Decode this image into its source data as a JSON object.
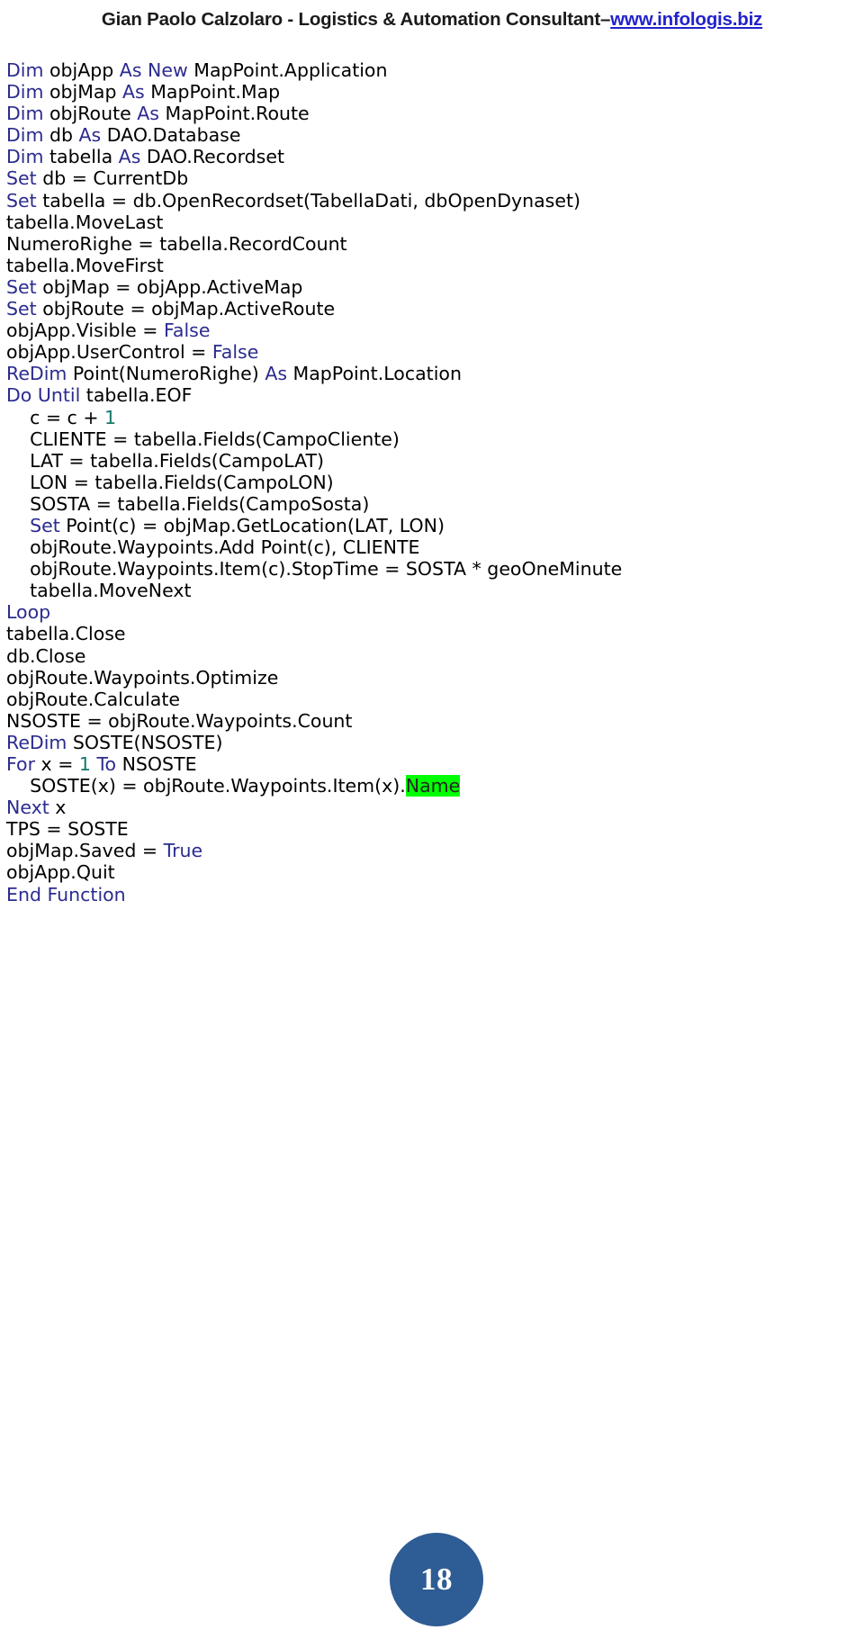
{
  "header": {
    "author_and_role": "Gian Paolo Calzolaro - Logistics & Automation Consultant ",
    "separator": "– ",
    "website": "www.infologis.biz"
  },
  "code": {
    "language": "VBA",
    "keyword_color": "#2b2b8f",
    "text_color": "#000000",
    "number_color": "#17776b",
    "highlight_color": "#00ff00",
    "lines": [
      [
        {
          "t": "Dim",
          "c": "kw"
        },
        {
          "t": " objApp ",
          "c": "plain"
        },
        {
          "t": "As New",
          "c": "kw"
        },
        {
          "t": " MapPoint.Application",
          "c": "plain"
        }
      ],
      [
        {
          "t": "Dim",
          "c": "kw"
        },
        {
          "t": " objMap ",
          "c": "plain"
        },
        {
          "t": "As",
          "c": "kw"
        },
        {
          "t": " MapPoint.Map",
          "c": "plain"
        }
      ],
      [
        {
          "t": "Dim",
          "c": "kw"
        },
        {
          "t": " objRoute ",
          "c": "plain"
        },
        {
          "t": "As",
          "c": "kw"
        },
        {
          "t": " MapPoint.Route",
          "c": "plain"
        }
      ],
      [
        {
          "t": "Dim",
          "c": "kw"
        },
        {
          "t": " db ",
          "c": "plain"
        },
        {
          "t": "As",
          "c": "kw"
        },
        {
          "t": " DAO.Database",
          "c": "plain"
        }
      ],
      [
        {
          "t": "Dim",
          "c": "kw"
        },
        {
          "t": " tabella ",
          "c": "plain"
        },
        {
          "t": "As",
          "c": "kw"
        },
        {
          "t": " DAO.Recordset",
          "c": "plain"
        }
      ],
      [
        {
          "t": "Set",
          "c": "kw"
        },
        {
          "t": " db = CurrentDb",
          "c": "plain"
        }
      ],
      [
        {
          "t": "Set",
          "c": "kw"
        },
        {
          "t": " tabella = db.OpenRecordset(TabellaDati, dbOpenDynaset)",
          "c": "plain"
        }
      ],
      [
        {
          "t": "tabella.MoveLast",
          "c": "plain"
        }
      ],
      [
        {
          "t": "NumeroRighe = tabella.RecordCount",
          "c": "plain"
        }
      ],
      [
        {
          "t": "tabella.MoveFirst",
          "c": "plain"
        }
      ],
      [
        {
          "t": "Set",
          "c": "kw"
        },
        {
          "t": " objMap = objApp.ActiveMap",
          "c": "plain"
        }
      ],
      [
        {
          "t": "Set",
          "c": "kw"
        },
        {
          "t": " objRoute = objMap.ActiveRoute",
          "c": "plain"
        }
      ],
      [
        {
          "t": "objApp.Visible = ",
          "c": "plain"
        },
        {
          "t": "False",
          "c": "kw"
        }
      ],
      [
        {
          "t": "objApp.UserControl = ",
          "c": "plain"
        },
        {
          "t": "False",
          "c": "kw"
        }
      ],
      [
        {
          "t": "ReDim",
          "c": "kw"
        },
        {
          "t": " Point(NumeroRighe) ",
          "c": "plain"
        },
        {
          "t": "As",
          "c": "kw"
        },
        {
          "t": " MapPoint.Location",
          "c": "plain"
        }
      ],
      [
        {
          "t": "Do Until",
          "c": "kw"
        },
        {
          "t": " tabella.EOF",
          "c": "plain"
        }
      ],
      [
        {
          "t": "    c = c + ",
          "c": "plain"
        },
        {
          "t": "1",
          "c": "num"
        }
      ],
      [
        {
          "t": "    CLIENTE = tabella.Fields(CampoCliente)",
          "c": "plain"
        }
      ],
      [
        {
          "t": "    LAT = tabella.Fields(CampoLAT)",
          "c": "plain"
        }
      ],
      [
        {
          "t": "    LON = tabella.Fields(CampoLON)",
          "c": "plain"
        }
      ],
      [
        {
          "t": "    SOSTA = tabella.Fields(CampoSosta)",
          "c": "plain"
        }
      ],
      [
        {
          "t": "    ",
          "c": "plain"
        },
        {
          "t": "Set",
          "c": "kw"
        },
        {
          "t": " Point(c) = objMap.GetLocation(LAT, LON)",
          "c": "plain"
        }
      ],
      [
        {
          "t": "    objRoute.Waypoints.Add Point(c), CLIENTE",
          "c": "plain"
        }
      ],
      [
        {
          "t": "    objRoute.Waypoints.Item(c).StopTime = SOSTA * geoOneMinute",
          "c": "plain"
        }
      ],
      [
        {
          "t": "    tabella.MoveNext",
          "c": "plain"
        }
      ],
      [
        {
          "t": "Loop",
          "c": "kw"
        }
      ],
      [
        {
          "t": "tabella.Close",
          "c": "plain"
        }
      ],
      [
        {
          "t": "db.Close",
          "c": "plain"
        }
      ],
      [
        {
          "t": "objRoute.Waypoints.Optimize",
          "c": "plain"
        }
      ],
      [
        {
          "t": "objRoute.Calculate",
          "c": "plain"
        }
      ],
      [
        {
          "t": "NSOSTE = objRoute.Waypoints.Count",
          "c": "plain"
        }
      ],
      [
        {
          "t": "ReDim",
          "c": "kw"
        },
        {
          "t": " SOSTE(NSOSTE)",
          "c": "plain"
        }
      ],
      [
        {
          "t": "For",
          "c": "kw"
        },
        {
          "t": " x = ",
          "c": "plain"
        },
        {
          "t": "1",
          "c": "num"
        },
        {
          "t": " ",
          "c": "plain"
        },
        {
          "t": "To",
          "c": "kw"
        },
        {
          "t": " NSOSTE",
          "c": "plain"
        }
      ],
      [
        {
          "t": "    SOSTE(x) = objRoute.Waypoints.Item(x).",
          "c": "plain"
        },
        {
          "t": "Name",
          "c": "hl"
        }
      ],
      [
        {
          "t": "Next",
          "c": "kw"
        },
        {
          "t": " x",
          "c": "plain"
        }
      ],
      [
        {
          "t": "TPS = SOSTE",
          "c": "plain"
        }
      ],
      [
        {
          "t": "objMap.Saved = ",
          "c": "plain"
        },
        {
          "t": "True",
          "c": "kw"
        }
      ],
      [
        {
          "t": "objApp.Quit",
          "c": "plain"
        }
      ],
      [
        {
          "t": "End Function",
          "c": "kw"
        }
      ]
    ]
  },
  "footer": {
    "page_number": "18",
    "badge_color": "#2e5c94"
  }
}
